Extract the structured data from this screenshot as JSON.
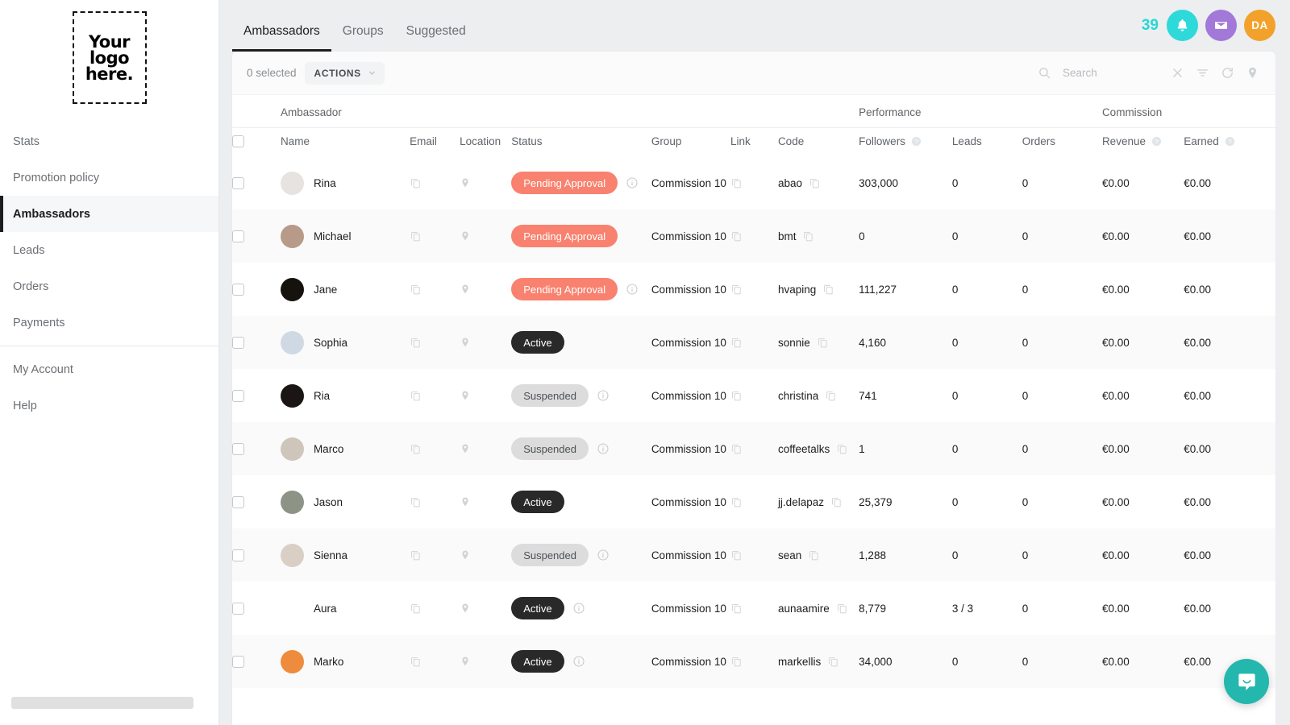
{
  "sidebar": {
    "logo_text": "Your\nlogo\nhere.",
    "items": [
      {
        "label": "Stats",
        "active": false
      },
      {
        "label": "Promotion policy",
        "active": false
      },
      {
        "label": "Ambassadors",
        "active": true
      },
      {
        "label": "Leads",
        "active": false
      },
      {
        "label": "Orders",
        "active": false
      },
      {
        "label": "Payments",
        "active": false
      },
      {
        "label": "My Account",
        "active": false,
        "after_divider": true
      },
      {
        "label": "Help",
        "active": false
      }
    ]
  },
  "header": {
    "tabs": [
      {
        "label": "Ambassadors",
        "active": true
      },
      {
        "label": "Groups",
        "active": false
      },
      {
        "label": "Suggested",
        "active": false
      }
    ],
    "notification_count": "39",
    "bell_icon": "bell-icon",
    "mail_icon": "envelope-icon",
    "avatar_initials": "DA"
  },
  "toolbar": {
    "selected_text": "0 selected",
    "actions_label": "ACTIONS",
    "chevron_icon": "chevron-down-icon",
    "search_icon": "search-icon",
    "search_value": "",
    "search_placeholder": "Search",
    "clear_icon": "close-icon",
    "filter_icon": "filter-icon",
    "refresh_icon": "refresh-icon",
    "location_icon": "map-pin-icon"
  },
  "table": {
    "group_headers": [
      {
        "label": "Ambassador"
      },
      {
        "label": "Performance"
      },
      {
        "label": "Commission"
      }
    ],
    "columns": [
      {
        "key": "checkbox",
        "label": ""
      },
      {
        "key": "name",
        "label": "Name",
        "help": false
      },
      {
        "key": "email",
        "label": "Email",
        "help": false
      },
      {
        "key": "location",
        "label": "Location",
        "help": false
      },
      {
        "key": "status",
        "label": "Status",
        "help": false
      },
      {
        "key": "group",
        "label": "Group",
        "help": false
      },
      {
        "key": "link",
        "label": "Link",
        "help": false
      },
      {
        "key": "code",
        "label": "Code",
        "help": false
      },
      {
        "key": "followers",
        "label": "Followers",
        "help": true
      },
      {
        "key": "leads",
        "label": "Leads",
        "help": false
      },
      {
        "key": "orders",
        "label": "Orders",
        "help": false
      },
      {
        "key": "revenue",
        "label": "Revenue",
        "help": true
      },
      {
        "key": "earned",
        "label": "Earned",
        "help": true
      }
    ],
    "rows": [
      {
        "name": "Rina",
        "avatar_color": "#e6e3e0",
        "status": "Pending Approval",
        "status_type": "pending",
        "status_info": true,
        "group": "Commission 10",
        "code": "abao",
        "followers": "303,000",
        "leads": "0",
        "orders": "0",
        "revenue": "€0.00",
        "earned": "€0.00"
      },
      {
        "name": "Michael",
        "avatar_color": "#b79a88",
        "status": "Pending Approval",
        "status_type": "pending",
        "status_info": false,
        "group": "Commission 10",
        "code": "bmt",
        "followers": "0",
        "leads": "0",
        "orders": "0",
        "revenue": "€0.00",
        "earned": "€0.00"
      },
      {
        "name": "Jane",
        "avatar_color": "#16130f",
        "status": "Pending Approval",
        "status_type": "pending",
        "status_info": true,
        "group": "Commission 10",
        "code": "hvaping",
        "followers": "111,227",
        "leads": "0",
        "orders": "0",
        "revenue": "€0.00",
        "earned": "€0.00"
      },
      {
        "name": "Sophia",
        "avatar_color": "#cfd9e4",
        "status": "Active",
        "status_type": "active",
        "status_info": false,
        "group": "Commission 10",
        "code": "sonnie",
        "followers": "4,160",
        "leads": "0",
        "orders": "0",
        "revenue": "€0.00",
        "earned": "€0.00"
      },
      {
        "name": "Ria",
        "avatar_color": "#1b1614",
        "status": "Suspended",
        "status_type": "susp",
        "status_info": true,
        "group": "Commission 10",
        "code": "christina",
        "followers": "741",
        "leads": "0",
        "orders": "0",
        "revenue": "€0.00",
        "earned": "€0.00"
      },
      {
        "name": "Marco",
        "avatar_color": "#cfc6bb",
        "status": "Suspended",
        "status_type": "susp",
        "status_info": true,
        "group": "Commission 10",
        "code": "coffeetalks",
        "followers": "1",
        "leads": "0",
        "orders": "0",
        "revenue": "€0.00",
        "earned": "€0.00"
      },
      {
        "name": "Jason",
        "avatar_color": "#8d9486",
        "status": "Active",
        "status_type": "active",
        "status_info": false,
        "group": "Commission 10",
        "code": "jj.delapaz",
        "followers": "25,379",
        "leads": "0",
        "orders": "0",
        "revenue": "€0.00",
        "earned": "€0.00"
      },
      {
        "name": "Sienna",
        "avatar_color": "#d9cfc4",
        "status": "Suspended",
        "status_type": "susp",
        "status_info": true,
        "group": "Commission 10",
        "code": "sean",
        "followers": "1,288",
        "leads": "0",
        "orders": "0",
        "revenue": "€0.00",
        "earned": "€0.00"
      },
      {
        "name": "Aura",
        "avatar_color": "#ffffff",
        "status": "Active",
        "status_type": "active",
        "status_info": true,
        "group": "Commission 10",
        "code": "aunaamire",
        "followers": "8,779",
        "leads": "3 / 3",
        "orders": "0",
        "revenue": "€0.00",
        "earned": "€0.00"
      },
      {
        "name": "Marko",
        "avatar_color": "#ef8b3c",
        "status": "Active",
        "status_type": "active",
        "status_info": true,
        "group": "Commission 10",
        "code": "markellis",
        "followers": "34,000",
        "leads": "0",
        "orders": "0",
        "revenue": "€0.00",
        "earned": "€0.00"
      }
    ]
  },
  "chat": {
    "icon": "chat-bubble-icon"
  },
  "colors": {
    "accent_teal": "#2ed9d9",
    "mail_purple": "#a278d8",
    "avatar_orange": "#f2a22a",
    "pill_pending": "#f8826f",
    "pill_active": "#292929",
    "pill_suspended": "#dcdcdc",
    "chat_teal": "#23b7ae"
  }
}
